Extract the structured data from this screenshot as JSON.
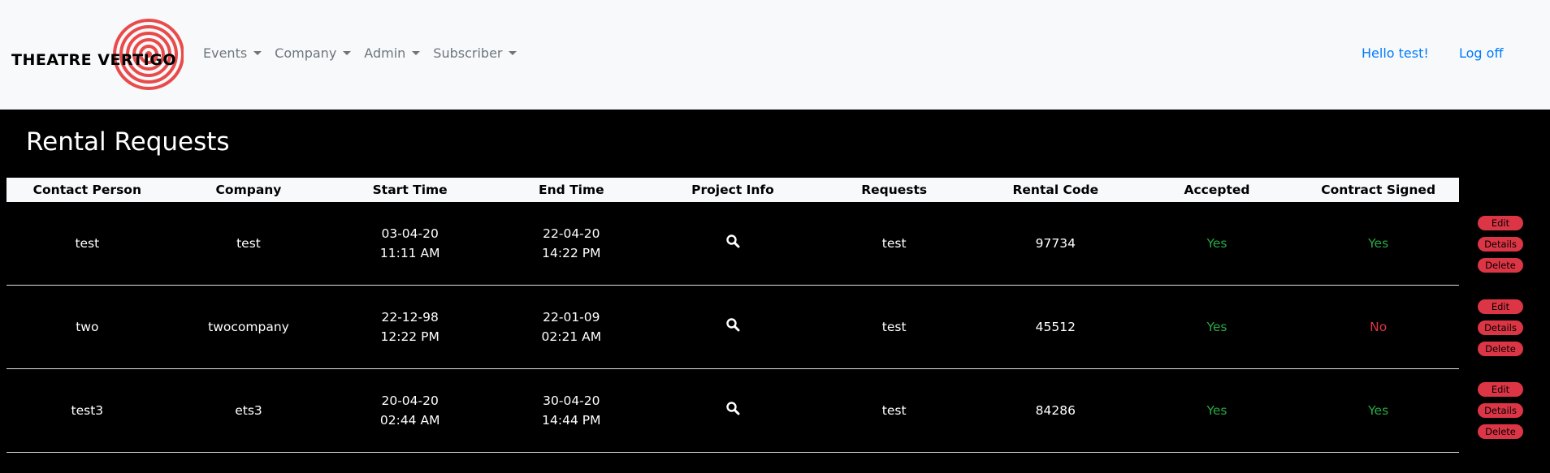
{
  "brand": {
    "name": "THEATRE VERTIGO",
    "accent": "#e94a4a"
  },
  "nav": {
    "menus": [
      {
        "label": "Events"
      },
      {
        "label": "Company"
      },
      {
        "label": "Admin"
      },
      {
        "label": "Subscriber"
      }
    ],
    "greeting": "Hello test!",
    "logoff": "Log off"
  },
  "page": {
    "title": "Rental Requests"
  },
  "table": {
    "headers": [
      "Contact Person",
      "Company",
      "Start Time",
      "End Time",
      "Project Info",
      "Requests",
      "Rental Code",
      "Accepted",
      "Contract Signed"
    ],
    "rows": [
      {
        "contact": "test",
        "company": "test",
        "start_date": "03-04-20",
        "start_time": "11:11 AM",
        "end_date": "22-04-20",
        "end_time": "14:22 PM",
        "requests": "test",
        "code": "97734",
        "accepted": "Yes",
        "signed": "Yes"
      },
      {
        "contact": "two",
        "company": "twocompany",
        "start_date": "22-12-98",
        "start_time": "12:22 PM",
        "end_date": "22-01-09",
        "end_time": "02:21 AM",
        "requests": "test",
        "code": "45512",
        "accepted": "Yes",
        "signed": "No"
      },
      {
        "contact": "test3",
        "company": "ets3",
        "start_date": "20-04-20",
        "start_time": "02:44 AM",
        "end_date": "30-04-20",
        "end_time": "14:44 PM",
        "requests": "test",
        "code": "84286",
        "accepted": "Yes",
        "signed": "Yes"
      }
    ],
    "actions": {
      "edit": "Edit",
      "details": "Details",
      "delete": "Delete"
    }
  },
  "icons": {
    "project_info": "magnifier-icon",
    "dropdown": "caret-down-icon"
  },
  "colors": {
    "yes": "#28a745",
    "no": "#dc3545",
    "link": "#007bff",
    "button": "#dc3545"
  }
}
